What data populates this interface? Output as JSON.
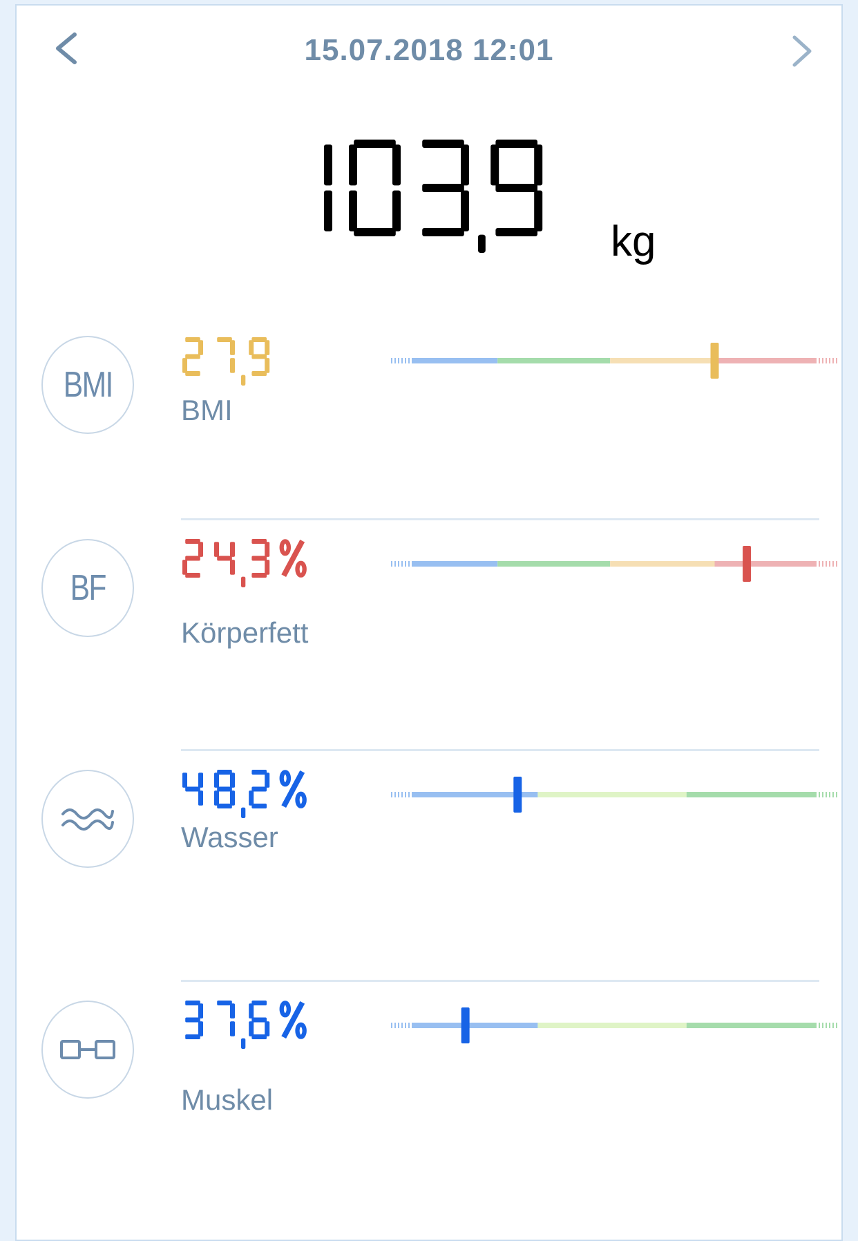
{
  "header": {
    "datetime": "15.07.2018 12:01",
    "prev_icon": "chevron-left-icon",
    "next_icon": "chevron-right-icon"
  },
  "weight": {
    "value": "103,9",
    "unit": "kg"
  },
  "metrics": [
    {
      "id": "bmi",
      "icon_text": "BMI",
      "value": "27,9",
      "label": "BMI",
      "color": "#e9bd5b",
      "marker_position": 0.75,
      "segments": [
        "#98bff1",
        "#a5dcab",
        "#f6dfb4",
        "#eeb2b4"
      ]
    },
    {
      "id": "bf",
      "icon_text": "BF",
      "value": "24,3%",
      "label": "Körperfett",
      "color": "#d9534f",
      "marker_position": 0.83,
      "segments": [
        "#98bff1",
        "#a5dcab",
        "#f6dfb4",
        "#eeb2b4"
      ]
    },
    {
      "id": "water",
      "icon": "water-wave-icon",
      "value": "48,2%",
      "label": "Wasser",
      "color": "#1763e6",
      "marker_position": 0.26,
      "segments": [
        "#98bff1",
        "#dff4c6",
        "#a5dcab"
      ]
    },
    {
      "id": "muscle",
      "icon": "dumbbell-icon",
      "value": "37,6%",
      "label": "Muskel",
      "color": "#1763e6",
      "marker_position": 0.13,
      "segments": [
        "#98bff1",
        "#dff4c6",
        "#a5dcab"
      ]
    }
  ]
}
